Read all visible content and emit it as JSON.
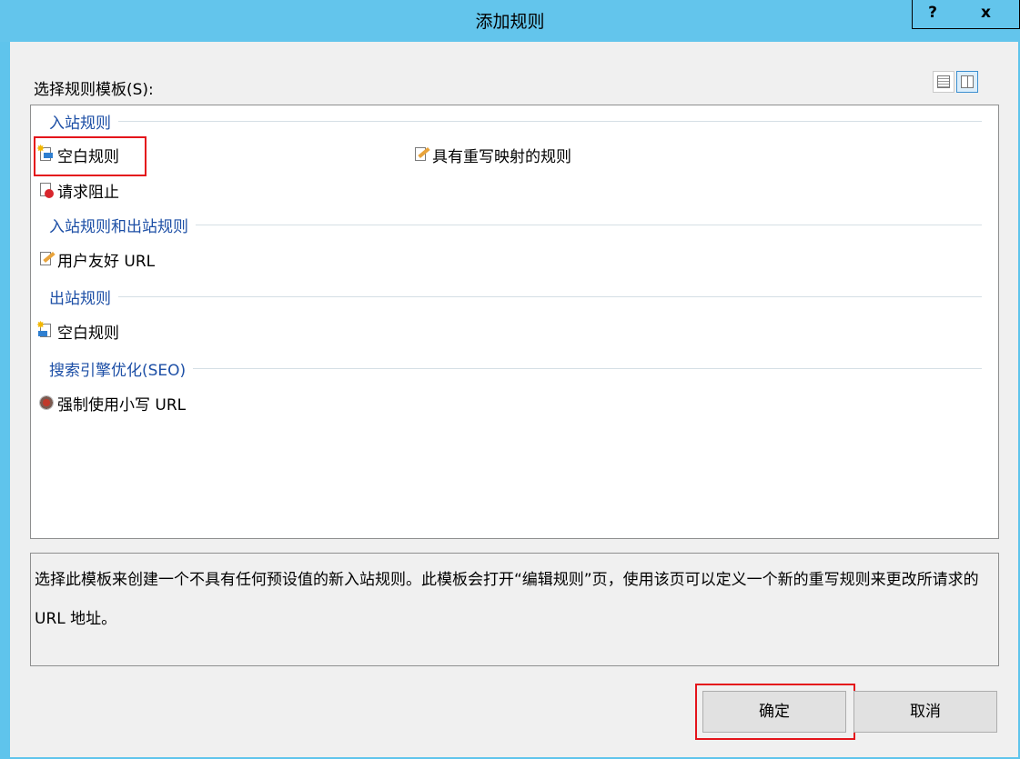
{
  "window": {
    "title": "添加规则",
    "help_label": "?",
    "close_label": "x"
  },
  "template_label": "选择规则模板(S):",
  "groups": [
    {
      "label": "入站规则"
    },
    {
      "label": "入站规则和出站规则"
    },
    {
      "label": "出站规则"
    },
    {
      "label": "搜索引擎优化(SEO)"
    }
  ],
  "items": {
    "inbound_blank": "空白规则",
    "rewrite_map": "具有重写映射的规则",
    "request_block": "请求阻止",
    "user_friendly_url": "用户友好 URL",
    "outbound_blank": "空白规则",
    "lowercase_url": "强制使用小写 URL"
  },
  "description": "选择此模板来创建一个不具有任何预设值的新入站规则。此模板会打开“编辑规则”页，使用该页可以定义一个新的重写规则来更改所请求的 URL 地址。",
  "buttons": {
    "ok": "确定",
    "cancel": "取消"
  },
  "colors": {
    "titlebar": "#63c5ec",
    "group_header": "#1d4fa6",
    "highlight": "#e4141b"
  }
}
